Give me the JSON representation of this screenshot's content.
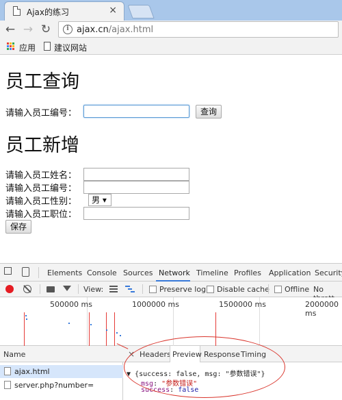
{
  "browser": {
    "tab_title": "Ajax的练习",
    "tab_close": "×",
    "url_host": "ajax.cn",
    "url_path": "/ajax.html",
    "bookmarks": [
      "应用",
      "建议网站"
    ]
  },
  "page": {
    "query_heading": "员工查询",
    "query_label": "请输入员工编号：",
    "query_button": "查询",
    "add_heading": "员工新增",
    "add_fields": [
      "请输入员工姓名：",
      "请输入员工编号：",
      "请输入员工性别：",
      "请输入员工职位："
    ],
    "gender_selected": "男 ▾",
    "save_button": "保存"
  },
  "devtools": {
    "tabs": [
      "Elements",
      "Console",
      "Sources",
      "Network",
      "Timeline",
      "Profiles",
      "Application",
      "Security"
    ],
    "active_tab": "Network",
    "toolbar": {
      "view_label": "View:",
      "preserve_log": "Preserve log",
      "disable_cache": "Disable cache",
      "offline": "Offline",
      "throttle": "No thrott"
    },
    "timeline_ticks": [
      "500000 ms",
      "1000000 ms",
      "1500000 ms",
      "2000000 ms"
    ],
    "name_header": "Name",
    "requests": [
      "ajax.html",
      "server.php?number="
    ],
    "preview_tabs": [
      "Headers",
      "Preview",
      "Response",
      "Timing"
    ],
    "preview_close": "×",
    "preview": {
      "summary": "{success: false, msg: \"参数错误\"}",
      "msg_key": "msg",
      "msg_value": "\"参数错误\"",
      "success_key": "success",
      "success_value": "false"
    }
  },
  "colors": {
    "record": "#e51c23",
    "active_underline": "#3879d9",
    "annotation": "#d9342b"
  }
}
